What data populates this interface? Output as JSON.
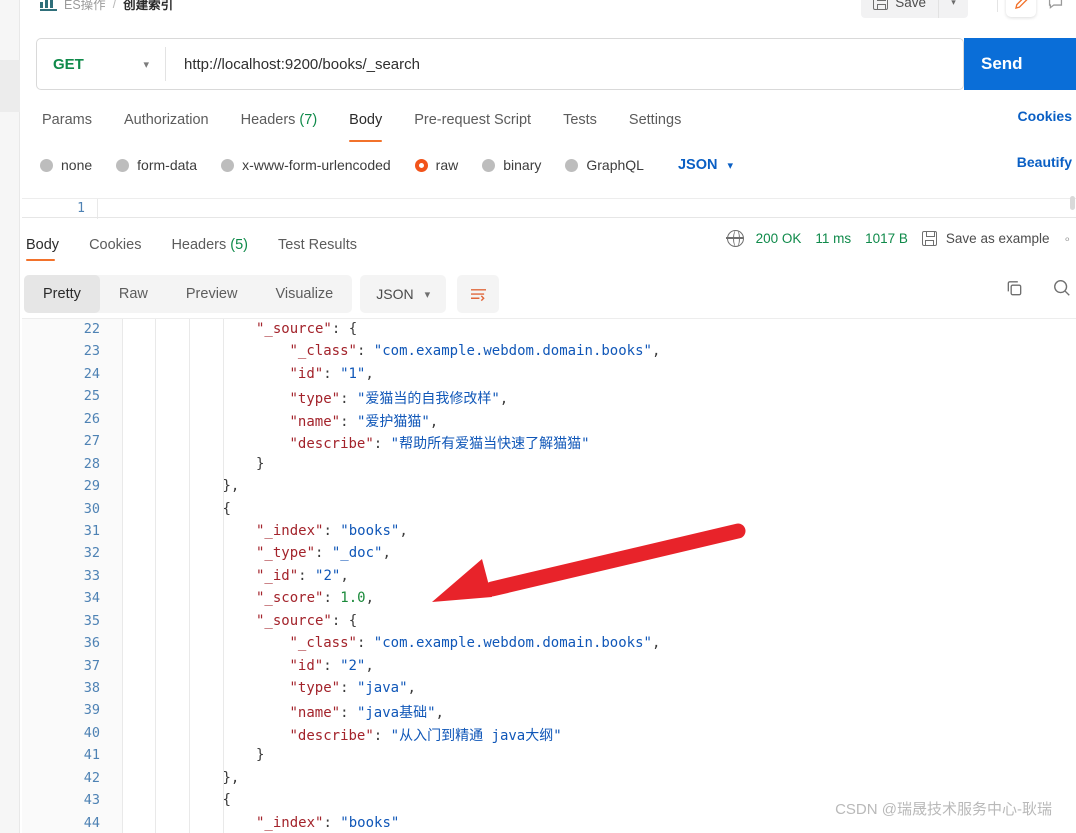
{
  "breadcrumb": {
    "collection": "ES操作",
    "separator": "/",
    "request": "创建索引",
    "icon": "collection-icon"
  },
  "topbar": {
    "save_label": "Save",
    "save_icon": "floppy-disk-icon",
    "save_caret_icon": "chevron-down-icon",
    "edit_icon": "pencil-icon",
    "comment_icon": "comment-icon"
  },
  "request": {
    "method": "GET",
    "method_caret_icon": "chevron-down-icon",
    "url": "http://localhost:9200/books/_search",
    "send_label": "Send",
    "send_caret_icon": "chevron-down-icon",
    "tabs": [
      {
        "label": "Params",
        "count": "",
        "active": false
      },
      {
        "label": "Authorization",
        "count": "",
        "active": false
      },
      {
        "label": "Headers",
        "count": "(7)",
        "active": false
      },
      {
        "label": "Body",
        "count": "",
        "active": true
      },
      {
        "label": "Pre-request Script",
        "count": "",
        "active": false
      },
      {
        "label": "Tests",
        "count": "",
        "active": false
      },
      {
        "label": "Settings",
        "count": "",
        "active": false
      }
    ],
    "cookies_link": "Cookies",
    "body_types": [
      {
        "label": "none",
        "selected": false
      },
      {
        "label": "form-data",
        "selected": false
      },
      {
        "label": "x-www-form-urlencoded",
        "selected": false
      },
      {
        "label": "raw",
        "selected": true
      },
      {
        "label": "binary",
        "selected": false
      },
      {
        "label": "GraphQL",
        "selected": false
      }
    ],
    "format": "JSON",
    "format_caret_icon": "chevron-down-icon",
    "beautify_label": "Beautify",
    "editor_first_line": "1"
  },
  "response": {
    "tabs": [
      {
        "label": "Body",
        "count": "",
        "active": true
      },
      {
        "label": "Cookies",
        "count": "",
        "active": false
      },
      {
        "label": "Headers",
        "count": "(5)",
        "active": false
      },
      {
        "label": "Test Results",
        "count": "",
        "active": false
      }
    ],
    "globe_icon": "globe-icon",
    "status_code": "200 OK",
    "time": "11 ms",
    "size": "1017 B",
    "save_example_label": "Save as example",
    "save_example_icon": "floppy-disk-icon",
    "kebab_icon": "more-options-icon",
    "view_modes": [
      {
        "label": "Pretty",
        "active": true
      },
      {
        "label": "Raw",
        "active": false
      },
      {
        "label": "Preview",
        "active": false
      },
      {
        "label": "Visualize",
        "active": false
      }
    ],
    "format": "JSON",
    "format_caret_icon": "chevron-down-icon",
    "wrap_icon": "word-wrap-icon",
    "copy_icon": "copy-icon",
    "search_icon": "search-icon"
  },
  "code": {
    "lines": [
      {
        "no": "22",
        "indent": 4,
        "tokens": [
          {
            "t": "k",
            "v": "\"_source\""
          },
          {
            "t": "p",
            "v": ": "
          },
          {
            "t": "p",
            "v": "{"
          }
        ]
      },
      {
        "no": "23",
        "indent": 5,
        "tokens": [
          {
            "t": "k",
            "v": "\"_class\""
          },
          {
            "t": "p",
            "v": ": "
          },
          {
            "t": "s",
            "v": "\"com.example.webdom.domain.books\""
          },
          {
            "t": "p",
            "v": ","
          }
        ]
      },
      {
        "no": "24",
        "indent": 5,
        "tokens": [
          {
            "t": "k",
            "v": "\"id\""
          },
          {
            "t": "p",
            "v": ": "
          },
          {
            "t": "s",
            "v": "\"1\""
          },
          {
            "t": "p",
            "v": ","
          }
        ]
      },
      {
        "no": "25",
        "indent": 5,
        "tokens": [
          {
            "t": "k",
            "v": "\"type\""
          },
          {
            "t": "p",
            "v": ": "
          },
          {
            "t": "s",
            "v": "\"爱猫当的自我修改样\""
          },
          {
            "t": "p",
            "v": ","
          }
        ]
      },
      {
        "no": "26",
        "indent": 5,
        "tokens": [
          {
            "t": "k",
            "v": "\"name\""
          },
          {
            "t": "p",
            "v": ": "
          },
          {
            "t": "s",
            "v": "\"爱护猫猫\""
          },
          {
            "t": "p",
            "v": ","
          }
        ]
      },
      {
        "no": "27",
        "indent": 5,
        "tokens": [
          {
            "t": "k",
            "v": "\"describe\""
          },
          {
            "t": "p",
            "v": ": "
          },
          {
            "t": "s",
            "v": "\"帮助所有爱猫当快速了解猫猫\""
          }
        ]
      },
      {
        "no": "28",
        "indent": 4,
        "tokens": [
          {
            "t": "p",
            "v": "}"
          }
        ]
      },
      {
        "no": "29",
        "indent": 3,
        "tokens": [
          {
            "t": "p",
            "v": "},"
          }
        ]
      },
      {
        "no": "30",
        "indent": 3,
        "tokens": [
          {
            "t": "p",
            "v": "{"
          }
        ]
      },
      {
        "no": "31",
        "indent": 4,
        "tokens": [
          {
            "t": "k",
            "v": "\"_index\""
          },
          {
            "t": "p",
            "v": ": "
          },
          {
            "t": "s",
            "v": "\"books\""
          },
          {
            "t": "p",
            "v": ","
          }
        ]
      },
      {
        "no": "32",
        "indent": 4,
        "tokens": [
          {
            "t": "k",
            "v": "\"_type\""
          },
          {
            "t": "p",
            "v": ": "
          },
          {
            "t": "s",
            "v": "\"_doc\""
          },
          {
            "t": "p",
            "v": ","
          }
        ]
      },
      {
        "no": "33",
        "indent": 4,
        "tokens": [
          {
            "t": "k",
            "v": "\"_id\""
          },
          {
            "t": "p",
            "v": ": "
          },
          {
            "t": "s",
            "v": "\"2\""
          },
          {
            "t": "p",
            "v": ","
          }
        ]
      },
      {
        "no": "34",
        "indent": 4,
        "tokens": [
          {
            "t": "k",
            "v": "\"_score\""
          },
          {
            "t": "p",
            "v": ": "
          },
          {
            "t": "n",
            "v": "1.0"
          },
          {
            "t": "p",
            "v": ","
          }
        ]
      },
      {
        "no": "35",
        "indent": 4,
        "tokens": [
          {
            "t": "k",
            "v": "\"_source\""
          },
          {
            "t": "p",
            "v": ": "
          },
          {
            "t": "p",
            "v": "{"
          }
        ]
      },
      {
        "no": "36",
        "indent": 5,
        "tokens": [
          {
            "t": "k",
            "v": "\"_class\""
          },
          {
            "t": "p",
            "v": ": "
          },
          {
            "t": "s",
            "v": "\"com.example.webdom.domain.books\""
          },
          {
            "t": "p",
            "v": ","
          }
        ]
      },
      {
        "no": "37",
        "indent": 5,
        "tokens": [
          {
            "t": "k",
            "v": "\"id\""
          },
          {
            "t": "p",
            "v": ": "
          },
          {
            "t": "s",
            "v": "\"2\""
          },
          {
            "t": "p",
            "v": ","
          }
        ]
      },
      {
        "no": "38",
        "indent": 5,
        "tokens": [
          {
            "t": "k",
            "v": "\"type\""
          },
          {
            "t": "p",
            "v": ": "
          },
          {
            "t": "s",
            "v": "\"java\""
          },
          {
            "t": "p",
            "v": ","
          }
        ]
      },
      {
        "no": "39",
        "indent": 5,
        "tokens": [
          {
            "t": "k",
            "v": "\"name\""
          },
          {
            "t": "p",
            "v": ": "
          },
          {
            "t": "s",
            "v": "\"java基础\""
          },
          {
            "t": "p",
            "v": ","
          }
        ]
      },
      {
        "no": "40",
        "indent": 5,
        "tokens": [
          {
            "t": "k",
            "v": "\"describe\""
          },
          {
            "t": "p",
            "v": ": "
          },
          {
            "t": "s",
            "v": "\"从入门到精通 java大纲\""
          }
        ]
      },
      {
        "no": "41",
        "indent": 4,
        "tokens": [
          {
            "t": "p",
            "v": "}"
          }
        ]
      },
      {
        "no": "42",
        "indent": 3,
        "tokens": [
          {
            "t": "p",
            "v": "},"
          }
        ]
      },
      {
        "no": "43",
        "indent": 3,
        "tokens": [
          {
            "t": "p",
            "v": "{"
          }
        ]
      },
      {
        "no": "44",
        "indent": 4,
        "tokens": [
          {
            "t": "k",
            "v": "\"_index\""
          },
          {
            "t": "p",
            "v": ": "
          },
          {
            "t": "s",
            "v": "\"books\""
          }
        ]
      }
    ]
  },
  "annotation": {
    "type": "red-arrow",
    "color": "#e8232a",
    "points_to_line": "34"
  },
  "watermark": "CSDN @瑞晟技术服务中心-耿瑞",
  "colors": {
    "accent_orange": "#f2722b",
    "send_blue": "#0a6ed8",
    "link_blue": "#0a5fc4",
    "green": "#0f8a4a",
    "key_red": "#a3232b",
    "string_blue": "#1057b8",
    "number_green": "#1a8a3a",
    "arrow_red": "#e8232a"
  }
}
